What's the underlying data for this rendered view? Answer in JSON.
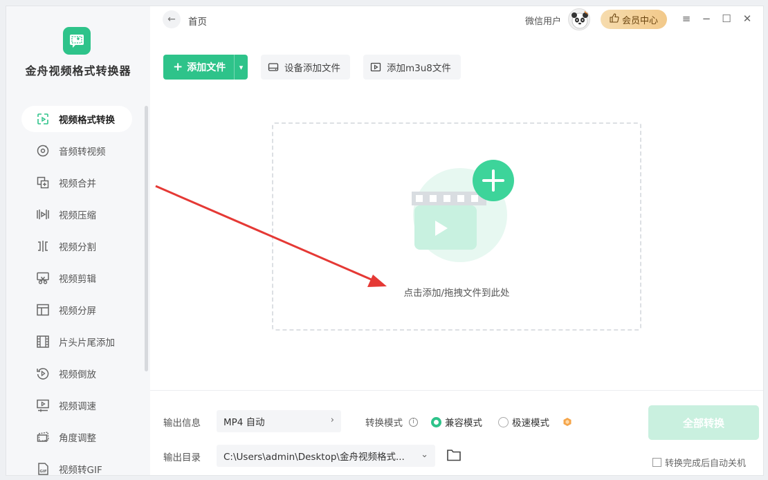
{
  "app": {
    "title": "金舟视频格式转换器"
  },
  "sidebar": {
    "items": [
      {
        "label": "视频格式转换",
        "icon": "video-convert-icon",
        "active": true
      },
      {
        "label": "音频转视频",
        "icon": "disc-icon"
      },
      {
        "label": "视频合并",
        "icon": "merge-icon"
      },
      {
        "label": "视频压缩",
        "icon": "compress-icon"
      },
      {
        "label": "视频分割",
        "icon": "split-icon"
      },
      {
        "label": "视频剪辑",
        "icon": "scissors-icon"
      },
      {
        "label": "视频分屏",
        "icon": "split-screen-icon"
      },
      {
        "label": "片头片尾添加",
        "icon": "film-icon"
      },
      {
        "label": "视频倒放",
        "icon": "reverse-icon"
      },
      {
        "label": "视频调速",
        "icon": "speed-icon"
      },
      {
        "label": "角度调整",
        "icon": "rotate-icon"
      },
      {
        "label": "视频转GIF",
        "icon": "gif-icon"
      }
    ]
  },
  "header": {
    "breadcrumb": "首页",
    "user_name": "微信用户",
    "vip_label": "会员中心"
  },
  "toolbar": {
    "add_file": "添加文件",
    "device_add": "设备添加文件",
    "add_m3u8": "添加m3u8文件"
  },
  "dropzone": {
    "hint": "点击添加/拖拽文件到此处"
  },
  "bottom": {
    "output_info_label": "输出信息",
    "output_format": "MP4 自动",
    "convert_mode_label": "转换模式",
    "mode_compatible": "兼容模式",
    "mode_fast": "极速模式",
    "output_dir_label": "输出目录",
    "output_dir": "C:\\Users\\admin\\Desktop\\金舟视频格式...",
    "convert_all": "全部转换",
    "auto_shutdown": "转换完成后自动关机"
  },
  "colors": {
    "accent": "#2ec38a",
    "vip": "#f2c98a",
    "arrow": "#e53935"
  }
}
